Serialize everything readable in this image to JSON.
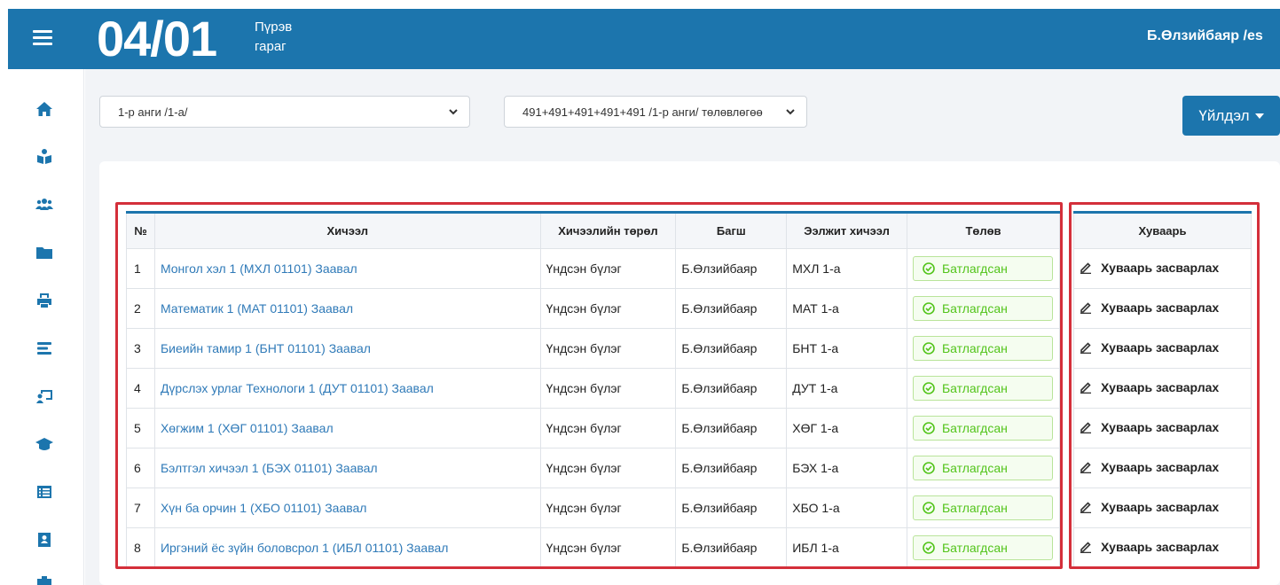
{
  "header": {
    "date": "04/01",
    "weekday_line1": "Пүрэв",
    "weekday_line2": "гараг",
    "user": "Б.Өлзийбаяр /es"
  },
  "sidebar": {
    "icons": [
      "home-icon",
      "teacher-icon",
      "users-icon",
      "folder-icon",
      "print-icon",
      "list-icon",
      "classroom-icon",
      "graduation-cap-icon",
      "table-list-icon",
      "contact-book-icon",
      "briefcase-icon"
    ]
  },
  "filters": {
    "class_select": "1-р анги /1-а/",
    "plan_select": "491+491+491+491+491 /1-р анги/ төлөвлөгөө"
  },
  "actions": {
    "label": "Үйлдэл"
  },
  "table": {
    "headers": {
      "num": "№",
      "lesson": "Хичээл",
      "type": "Хичээлийн төрөл",
      "teacher": "Багш",
      "alt": "Ээлжит хичээл",
      "status": "Төлөв",
      "schedule": "Хуваарь"
    },
    "rows": [
      {
        "num": "1",
        "lesson": "Монгол хэл 1 (МХЛ 01101) Заавал",
        "type": "Үндсэн бүлэг",
        "teacher": "Б.Өлзийбаяр",
        "alt": "МХЛ 1-а",
        "status": "Батлагдсан",
        "schedule": "Хуваарь засварлах"
      },
      {
        "num": "2",
        "lesson": "Математик 1 (МАТ 01101) Заавал",
        "type": "Үндсэн бүлэг",
        "teacher": "Б.Өлзийбаяр",
        "alt": "МАТ 1-а",
        "status": "Батлагдсан",
        "schedule": "Хуваарь засварлах"
      },
      {
        "num": "3",
        "lesson": "Биеийн тамир 1 (БНТ 01101) Заавал",
        "type": "Үндсэн бүлэг",
        "teacher": "Б.Өлзийбаяр",
        "alt": "БНТ 1-а",
        "status": "Батлагдсан",
        "schedule": "Хуваарь засварлах"
      },
      {
        "num": "4",
        "lesson": "Дүрслэх урлаг Технологи 1 (ДУТ 01101) Заавал",
        "type": "Үндсэн бүлэг",
        "teacher": "Б.Өлзийбаяр",
        "alt": "ДУТ 1-а",
        "status": "Батлагдсан",
        "schedule": "Хуваарь засварлах"
      },
      {
        "num": "5",
        "lesson": "Хөгжим 1 (ХӨГ 01101) Заавал",
        "type": "Үндсэн бүлэг",
        "teacher": "Б.Өлзийбаяр",
        "alt": "ХӨГ 1-а",
        "status": "Батлагдсан",
        "schedule": "Хуваарь засварлах"
      },
      {
        "num": "6",
        "lesson": "Бэлтгэл хичээл 1 (БЭХ 01101) Заавал",
        "type": "Үндсэн бүлэг",
        "teacher": "Б.Өлзийбаяр",
        "alt": "БЭХ 1-а",
        "status": "Батлагдсан",
        "schedule": "Хуваарь засварлах"
      },
      {
        "num": "7",
        "lesson": "Хүн ба орчин 1 (ХБО 01101) Заавал",
        "type": "Үндсэн бүлэг",
        "teacher": "Б.Өлзийбаяр",
        "alt": "ХБО 1-а",
        "status": "Батлагдсан",
        "schedule": "Хуваарь засварлах"
      },
      {
        "num": "8",
        "lesson": "Иргэний ёс зүйн боловсрол 1 (ИБЛ 01101) Заавал",
        "type": "Үндсэн бүлэг",
        "teacher": "Б.Өлзийбаяр",
        "alt": "ИБЛ 1-а",
        "status": "Батлагдсан",
        "schedule": "Хуваарь засварлах"
      }
    ]
  },
  "colors": {
    "primary": "#1c75ad",
    "link": "#2f7ab8",
    "status_green": "#52c41a",
    "highlight_red": "#d42f3a"
  }
}
